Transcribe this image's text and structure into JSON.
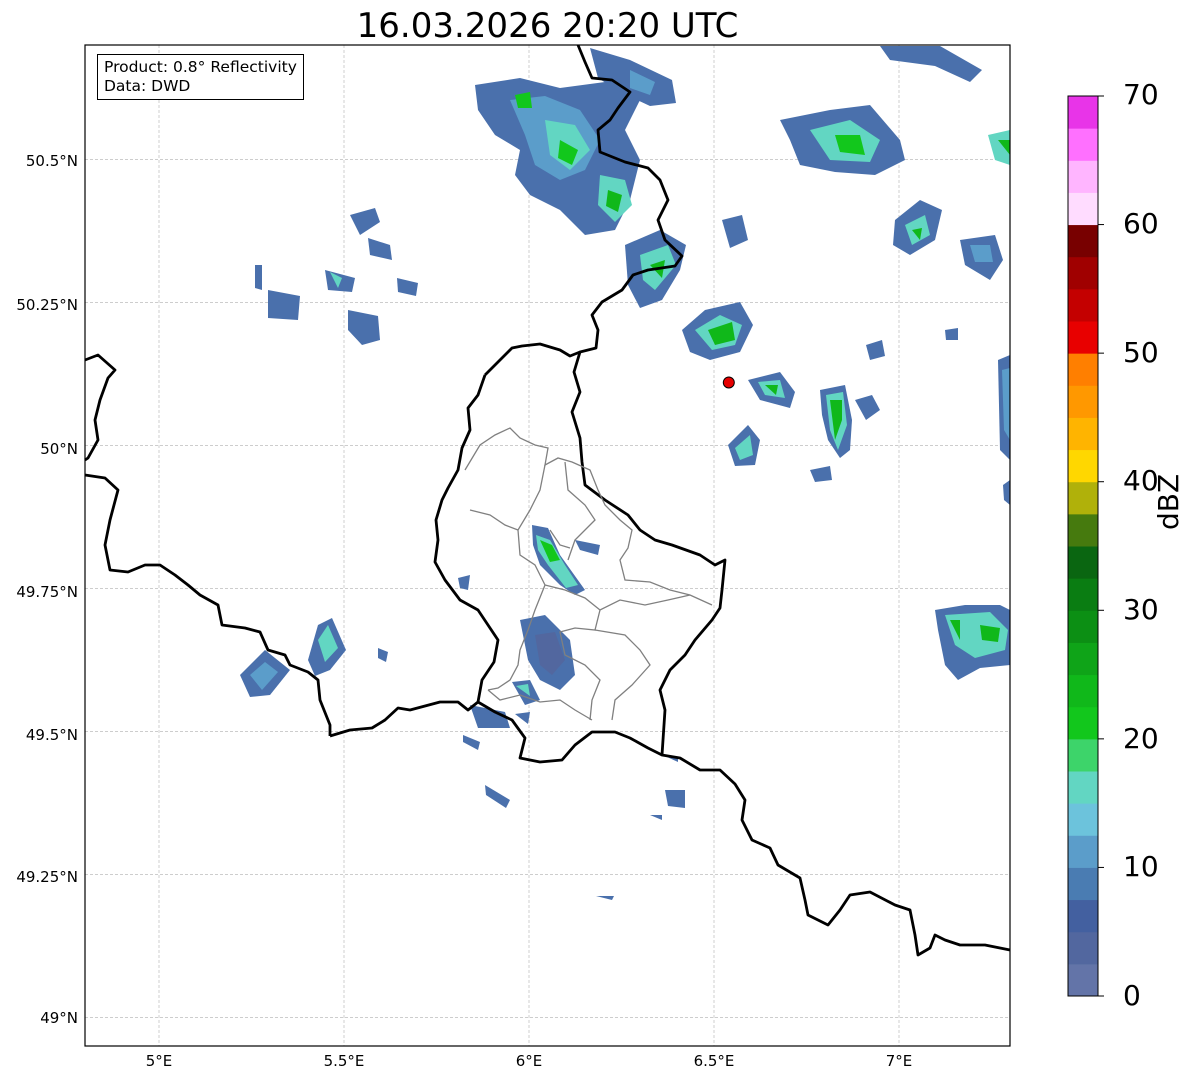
{
  "title": "16.03.2026 20:20 UTC",
  "info": {
    "product": "Product: 0.8° Reflectivity",
    "source": "Data: DWD"
  },
  "axes": {
    "lat_ticks": [
      "50.5°N",
      "50.25°N",
      "50°N",
      "49.75°N",
      "49.5°N",
      "49.25°N",
      "49°N"
    ],
    "lon_ticks": [
      "5°E",
      "5.5°E",
      "6°E",
      "6.5°E",
      "7°E"
    ],
    "lon_range": [
      4.8,
      7.3
    ],
    "lat_range": [
      48.95,
      50.7
    ],
    "grid": true
  },
  "colorbar": {
    "label": "dBZ",
    "ticks": [
      "0",
      "10",
      "20",
      "30",
      "40",
      "50",
      "60",
      "70"
    ],
    "range": [
      0,
      70
    ],
    "step": 2.5,
    "colors": [
      "#6374a8",
      "#52679f",
      "#4360a0",
      "#4a7cb2",
      "#5b9dca",
      "#6cc3dc",
      "#62d6c2",
      "#3dd46a",
      "#12c71c",
      "#10b81a",
      "#0fa418",
      "#0c8f14",
      "#0a7d12",
      "#0a6611",
      "#467a0e",
      "#b0b10a",
      "#ffd700",
      "#ffb400",
      "#ff9800",
      "#ff7f00",
      "#e80000",
      "#c40000",
      "#a00000",
      "#780000",
      "#ffdcff",
      "#ffb5ff",
      "#ff70ff",
      "#e834e8"
    ]
  },
  "marker": {
    "lon": 6.54,
    "lat": 50.11,
    "color": "#e60000"
  },
  "colors": {
    "border": "#000000",
    "districts": "#808080",
    "grid": "#b0b0b0"
  }
}
